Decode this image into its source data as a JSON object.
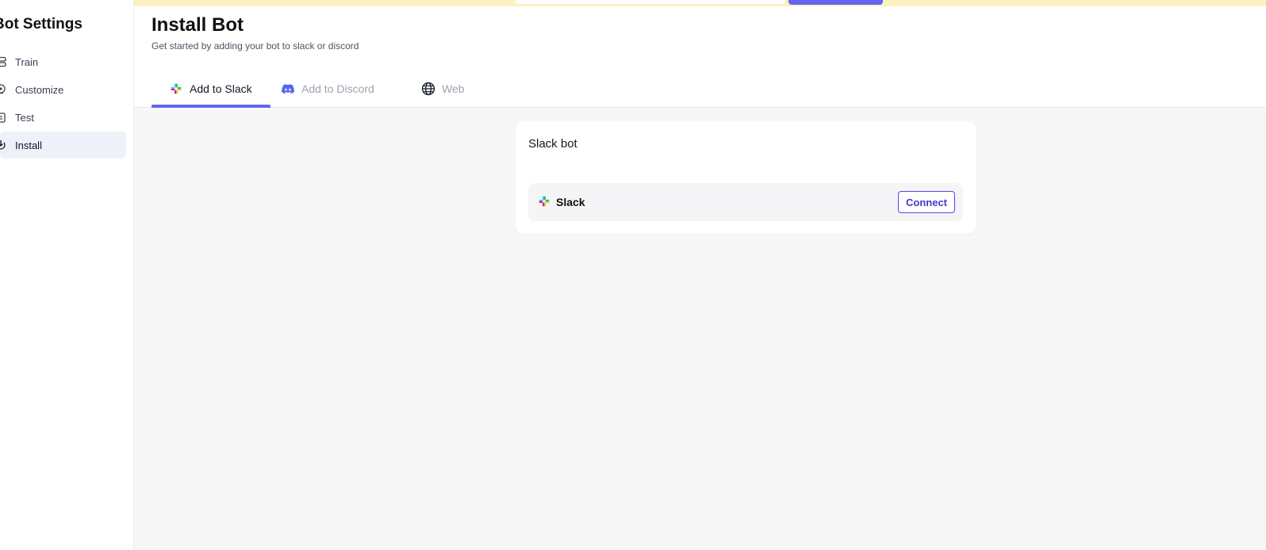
{
  "sidebar": {
    "title": "Bot Settings",
    "items": [
      {
        "label": "Train",
        "icon": "database-icon",
        "active": false
      },
      {
        "label": "Customize",
        "icon": "palette-icon",
        "active": false
      },
      {
        "label": "Test",
        "icon": "clipboard-icon",
        "active": false
      },
      {
        "label": "Install",
        "icon": "install-icon",
        "active": true
      }
    ]
  },
  "header": {
    "title": "Install Bot",
    "subtitle": "Get started by adding your bot to slack or discord"
  },
  "tabs": [
    {
      "label": "Add to Slack",
      "icon": "slack-icon",
      "active": true
    },
    {
      "label": "Add to Discord",
      "icon": "discord-icon",
      "active": false
    },
    {
      "label": "Web",
      "icon": "globe-icon",
      "active": false
    }
  ],
  "card": {
    "title": "Slack bot",
    "integration": {
      "name": "Slack",
      "icon": "slack-icon",
      "button_label": "Connect"
    }
  },
  "colors": {
    "accent": "#6366f1",
    "banner": "#fdf0c2",
    "background": "#f7f7f8",
    "discord": "#5865f2"
  }
}
